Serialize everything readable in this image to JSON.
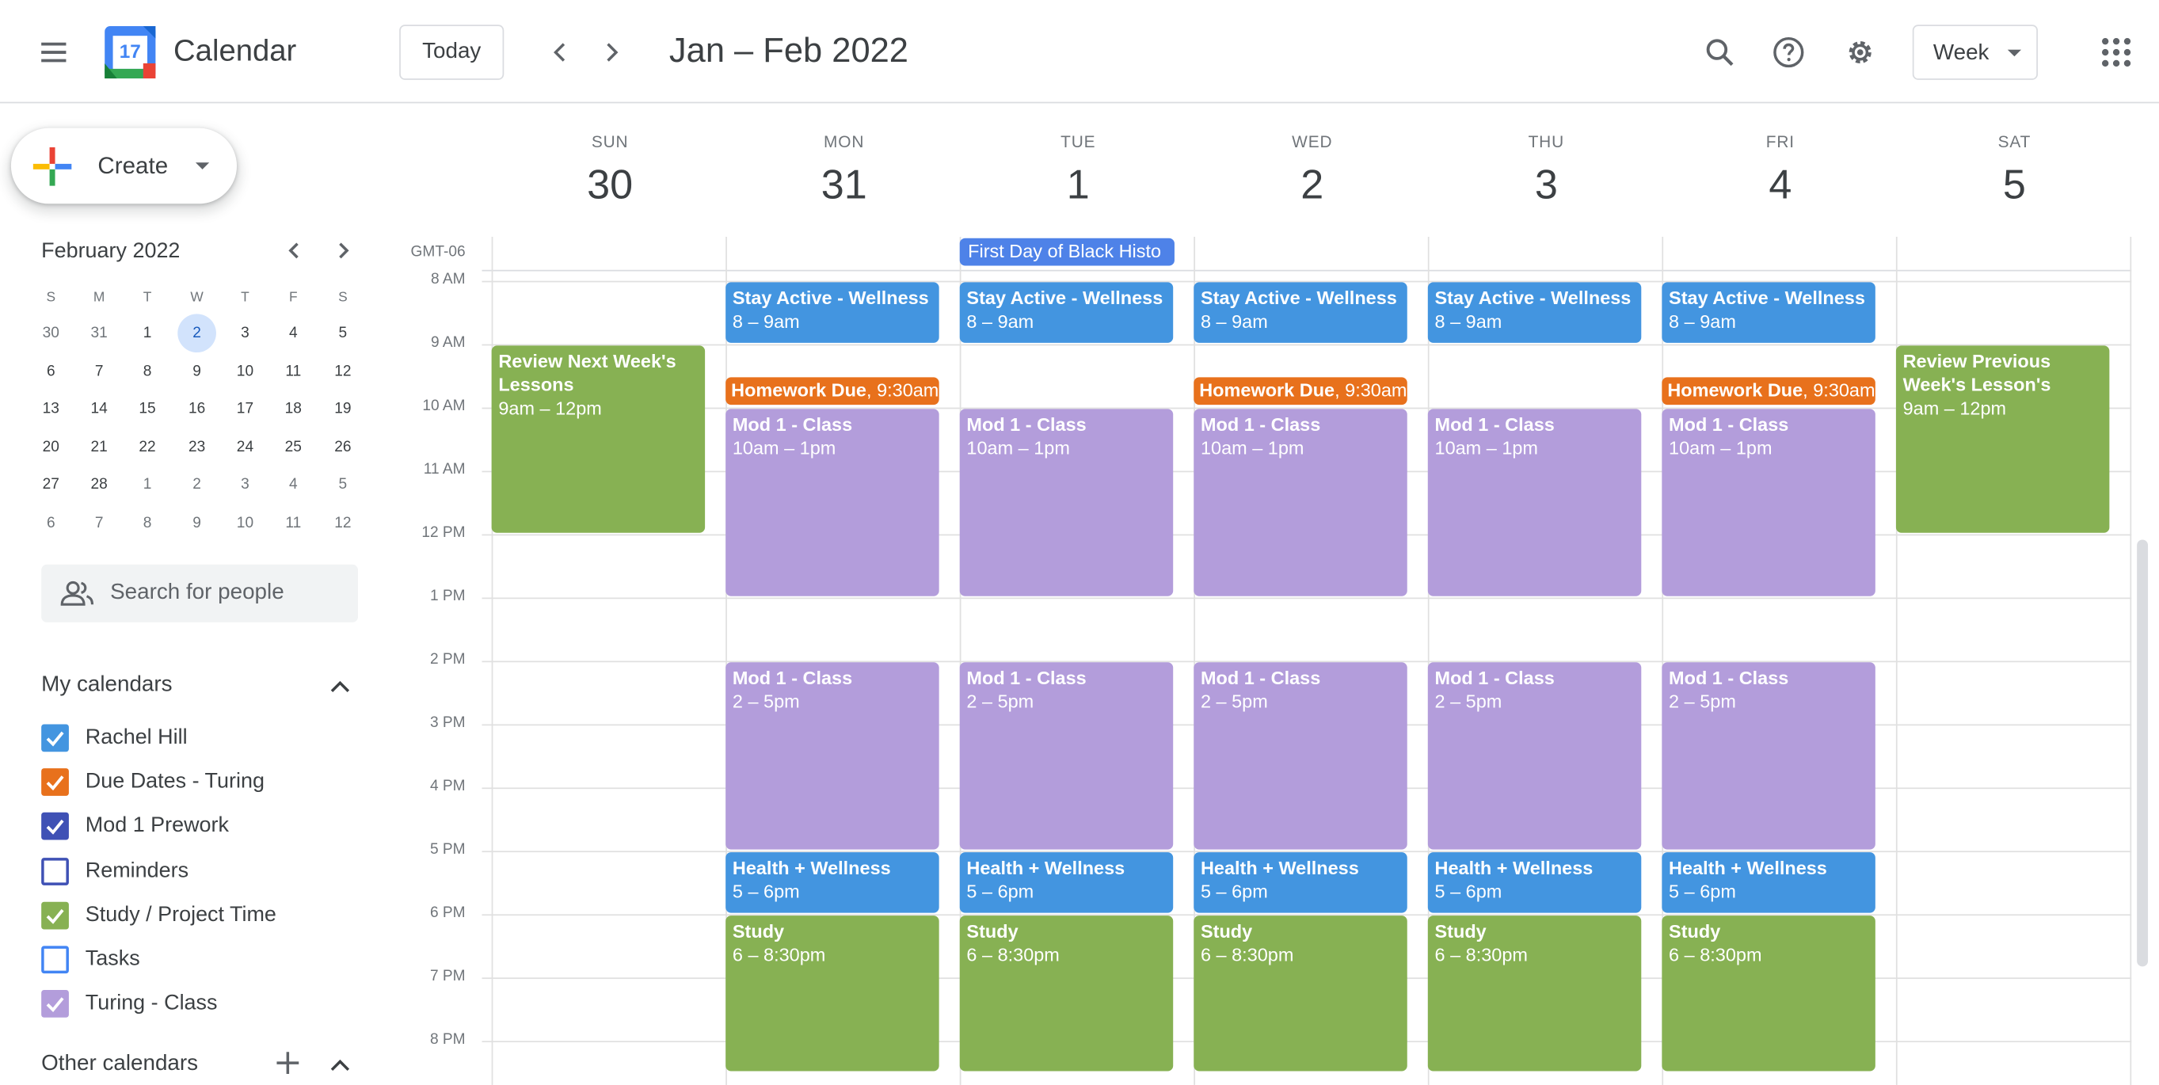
{
  "app": {
    "title": "Calendar",
    "logo_number": "17"
  },
  "toolbar": {
    "today_label": "Today",
    "date_range": "Jan – Feb 2022",
    "view_label": "Week"
  },
  "sidebar": {
    "create_label": "Create",
    "mini_calendar": {
      "month_title": "February 2022",
      "weekday_heads": [
        "S",
        "M",
        "T",
        "W",
        "T",
        "F",
        "S"
      ],
      "weeks": [
        [
          "30",
          "31",
          "1",
          "2",
          "3",
          "4",
          "5"
        ],
        [
          "6",
          "7",
          "8",
          "9",
          "10",
          "11",
          "12"
        ],
        [
          "13",
          "14",
          "15",
          "16",
          "17",
          "18",
          "19"
        ],
        [
          "20",
          "21",
          "22",
          "23",
          "24",
          "25",
          "26"
        ],
        [
          "27",
          "28",
          "1",
          "2",
          "3",
          "4",
          "5"
        ],
        [
          "6",
          "7",
          "8",
          "9",
          "10",
          "11",
          "12"
        ]
      ],
      "selected": "2"
    },
    "search_placeholder": "Search for people",
    "my_calendars_title": "My calendars",
    "my_calendars": [
      {
        "label": "Rachel Hill",
        "color": "#4395e0",
        "checked": true
      },
      {
        "label": "Due Dates - Turing",
        "color": "#e8711c",
        "checked": true
      },
      {
        "label": "Mod 1 Prework",
        "color": "#3f51b5",
        "checked": true
      },
      {
        "label": "Reminders",
        "color": "#3f51b5",
        "checked": false
      },
      {
        "label": "Study / Project Time",
        "color": "#87b153",
        "checked": true
      },
      {
        "label": "Tasks",
        "color": "#4285f4",
        "checked": false
      },
      {
        "label": "Turing - Class",
        "color": "#b39ddb",
        "checked": true
      }
    ],
    "other_calendars_title": "Other calendars"
  },
  "week": {
    "days": [
      {
        "dow": "SUN",
        "num": "30"
      },
      {
        "dow": "MON",
        "num": "31"
      },
      {
        "dow": "TUE",
        "num": "1"
      },
      {
        "dow": "WED",
        "num": "2"
      },
      {
        "dow": "THU",
        "num": "3"
      },
      {
        "dow": "FRI",
        "num": "4"
      },
      {
        "dow": "SAT",
        "num": "5"
      }
    ],
    "timezone": "GMT-06",
    "hours": [
      "8 AM",
      "9 AM",
      "10 AM",
      "11 AM",
      "12 PM",
      "1 PM",
      "2 PM",
      "3 PM",
      "4 PM",
      "5 PM",
      "6 PM",
      "7 PM",
      "8 PM"
    ],
    "all_day_events": [
      {
        "day": 2,
        "title": "First Day of Black Histo",
        "color": "#4e82e8"
      }
    ],
    "events": [
      {
        "day": 0,
        "start": 9,
        "end": 12,
        "title": "Review Next Week's Lessons",
        "time": "9am – 12pm",
        "color": "green"
      },
      {
        "day": 6,
        "start": 9,
        "end": 12,
        "title": "Review Previous Week's Lesson's",
        "time": "9am – 12pm",
        "color": "green"
      },
      {
        "day": 1,
        "start": 8,
        "end": 9,
        "title": "Stay Active - Wellness",
        "time": "8 – 9am",
        "color": "blue"
      },
      {
        "day": 2,
        "start": 8,
        "end": 9,
        "title": "Stay Active - Wellness",
        "time": "8 – 9am",
        "color": "blue"
      },
      {
        "day": 3,
        "start": 8,
        "end": 9,
        "title": "Stay Active - Wellness",
        "time": "8 – 9am",
        "color": "blue"
      },
      {
        "day": 4,
        "start": 8,
        "end": 9,
        "title": "Stay Active - Wellness",
        "time": "8 – 9am",
        "color": "blue"
      },
      {
        "day": 5,
        "start": 8,
        "end": 9,
        "title": "Stay Active - Wellness",
        "time": "8 – 9am",
        "color": "blue"
      },
      {
        "day": 1,
        "start": 9.5,
        "end": 9.97,
        "title": "Homework Due",
        "time": "9:30am",
        "color": "orange",
        "inline": true
      },
      {
        "day": 3,
        "start": 9.5,
        "end": 9.97,
        "title": "Homework Due",
        "time": "9:30am",
        "color": "orange",
        "inline": true
      },
      {
        "day": 5,
        "start": 9.5,
        "end": 9.97,
        "title": "Homework Due",
        "time": "9:30am",
        "color": "orange",
        "inline": true
      },
      {
        "day": 1,
        "start": 10,
        "end": 13,
        "title": "Mod 1 - Class",
        "time": "10am – 1pm",
        "color": "purple"
      },
      {
        "day": 2,
        "start": 10,
        "end": 13,
        "title": "Mod 1 - Class",
        "time": "10am – 1pm",
        "color": "purple"
      },
      {
        "day": 3,
        "start": 10,
        "end": 13,
        "title": "Mod 1 - Class",
        "time": "10am – 1pm",
        "color": "purple"
      },
      {
        "day": 4,
        "start": 10,
        "end": 13,
        "title": "Mod 1 - Class",
        "time": "10am – 1pm",
        "color": "purple"
      },
      {
        "day": 5,
        "start": 10,
        "end": 13,
        "title": "Mod 1 - Class",
        "time": "10am – 1pm",
        "color": "purple"
      },
      {
        "day": 1,
        "start": 14,
        "end": 17,
        "title": "Mod 1 - Class",
        "time": "2 – 5pm",
        "color": "purple"
      },
      {
        "day": 2,
        "start": 14,
        "end": 17,
        "title": "Mod 1 - Class",
        "time": "2 – 5pm",
        "color": "purple"
      },
      {
        "day": 3,
        "start": 14,
        "end": 17,
        "title": "Mod 1 - Class",
        "time": "2 – 5pm",
        "color": "purple"
      },
      {
        "day": 4,
        "start": 14,
        "end": 17,
        "title": "Mod 1 - Class",
        "time": "2 – 5pm",
        "color": "purple"
      },
      {
        "day": 5,
        "start": 14,
        "end": 17,
        "title": "Mod 1 - Class",
        "time": "2 – 5pm",
        "color": "purple"
      },
      {
        "day": 1,
        "start": 17,
        "end": 18,
        "title": "Health + Wellness",
        "time": "5 – 6pm",
        "color": "blue"
      },
      {
        "day": 2,
        "start": 17,
        "end": 18,
        "title": "Health + Wellness",
        "time": "5 – 6pm",
        "color": "blue"
      },
      {
        "day": 3,
        "start": 17,
        "end": 18,
        "title": "Health + Wellness",
        "time": "5 – 6pm",
        "color": "blue"
      },
      {
        "day": 4,
        "start": 17,
        "end": 18,
        "title": "Health + Wellness",
        "time": "5 – 6pm",
        "color": "blue"
      },
      {
        "day": 5,
        "start": 17,
        "end": 18,
        "title": "Health + Wellness",
        "time": "5 – 6pm",
        "color": "blue"
      },
      {
        "day": 1,
        "start": 18,
        "end": 20.5,
        "title": "Study",
        "time": "6 – 8:30pm",
        "color": "green"
      },
      {
        "day": 2,
        "start": 18,
        "end": 20.5,
        "title": "Study",
        "time": "6 – 8:30pm",
        "color": "green"
      },
      {
        "day": 3,
        "start": 18,
        "end": 20.5,
        "title": "Study",
        "time": "6 – 8:30pm",
        "color": "green"
      },
      {
        "day": 4,
        "start": 18,
        "end": 20.5,
        "title": "Study",
        "time": "6 – 8:30pm",
        "color": "green"
      },
      {
        "day": 5,
        "start": 18,
        "end": 20.5,
        "title": "Study",
        "time": "6 – 8:30pm",
        "color": "green"
      }
    ]
  }
}
